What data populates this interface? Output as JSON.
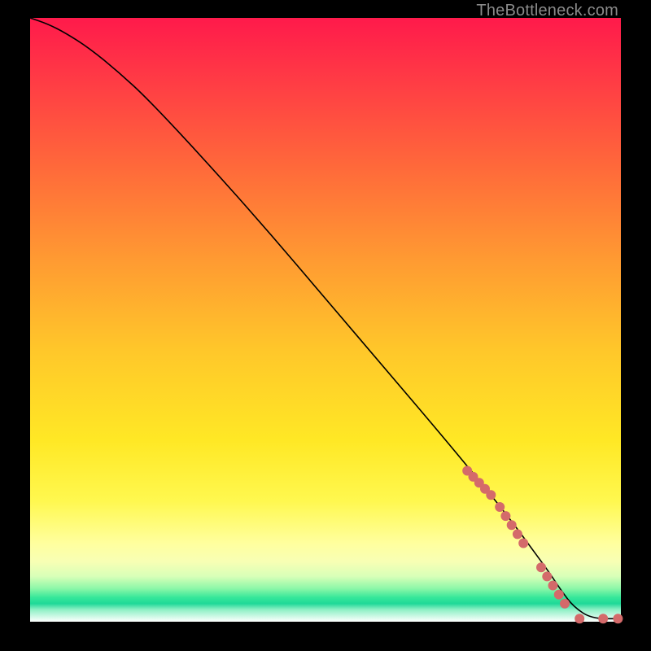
{
  "watermark": "TheBottleneck.com",
  "colors": {
    "marker": "#d46a6a",
    "curve": "#000000",
    "background": "#000000"
  },
  "chart_data": {
    "type": "line",
    "title": "",
    "xlabel": "",
    "ylabel": "",
    "xlim": [
      0,
      100
    ],
    "ylim": [
      0,
      100
    ],
    "grid": false,
    "series": [
      {
        "name": "curve",
        "x": [
          0,
          3,
          6,
          10,
          15,
          20,
          30,
          40,
          50,
          60,
          70,
          78,
          82,
          85,
          88,
          90,
          92,
          95,
          100
        ],
        "y": [
          100,
          99,
          97.5,
          95,
          91,
          86.5,
          76,
          65,
          53.5,
          42,
          30.5,
          21,
          16,
          12,
          8,
          5,
          2.5,
          0.5,
          0.5
        ]
      }
    ],
    "markers": {
      "name": "highlighted-points",
      "x": [
        74,
        75,
        76,
        77,
        78,
        79.5,
        80.5,
        81.5,
        82.5,
        83.5,
        86.5,
        87.5,
        88.5,
        89.5,
        90.5,
        93,
        97,
        99.5
      ],
      "y": [
        25,
        24,
        23,
        22,
        21,
        19,
        17.5,
        16,
        14.5,
        13,
        9,
        7.5,
        6,
        4.5,
        3,
        0.5,
        0.5,
        0.5
      ]
    }
  }
}
